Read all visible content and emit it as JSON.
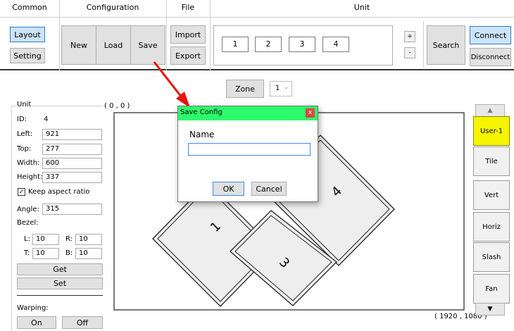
{
  "toolbar": {
    "headers": {
      "common": "Common",
      "configuration": "Configuration",
      "file": "File",
      "unit": "Unit"
    },
    "common": {
      "layout": "Layout",
      "setting": "Setting"
    },
    "configuration": {
      "new": "New",
      "load": "Load",
      "save": "Save"
    },
    "file": {
      "import": "Import",
      "export": "Export"
    },
    "unit": {
      "numbers": [
        "1",
        "2",
        "3",
        "4"
      ],
      "plus": "+",
      "minus": "-",
      "search": "Search",
      "connect": "Connect",
      "disconnect": "Disconnect"
    }
  },
  "zone": {
    "label": "Zone",
    "value": "1"
  },
  "unit_panel": {
    "title": "Unit",
    "id_label": "ID:",
    "id_value": "4",
    "left_label": "Left:",
    "left_value": "921",
    "top_label": "Top:",
    "top_value": "277",
    "width_label": "Width:",
    "width_value": "600",
    "height_label": "Height:",
    "height_value": "337",
    "keep_aspect": "Keep aspect ratio",
    "keep_aspect_checked": true,
    "angle_label": "Angle:",
    "angle_value": "315",
    "bezel_label": "Bezel:",
    "l_label": "L:",
    "l_value": "10",
    "r_label": "R:",
    "r_value": "10",
    "t_label": "T:",
    "t_value": "10",
    "b_label": "B:",
    "b_value": "10",
    "get": "Get",
    "set": "Set",
    "warping_label": "Warping:",
    "on": "On",
    "off": "Off"
  },
  "canvas": {
    "origin_label": "( 0 , 0 )",
    "extent_label": "( 1920 , 1080 )",
    "screens": [
      "1",
      "3",
      "4"
    ]
  },
  "side_buttons": {
    "up": "▲",
    "user1": "User-1",
    "tile": "Tile",
    "vert": "Vert",
    "horiz": "Horiz",
    "slash": "Slash",
    "fan": "Fan",
    "down": "▼"
  },
  "dialog": {
    "title": "Save Config",
    "close": "x",
    "name_label": "Name",
    "name_value": "",
    "ok": "OK",
    "cancel": "Cancel"
  },
  "colors": {
    "dialog_title": "#2dfb6c",
    "close_button": "#e04343",
    "arrow": "#e8140c",
    "selected_preset": "#f6f400",
    "active_blue": "#cce4f7"
  }
}
